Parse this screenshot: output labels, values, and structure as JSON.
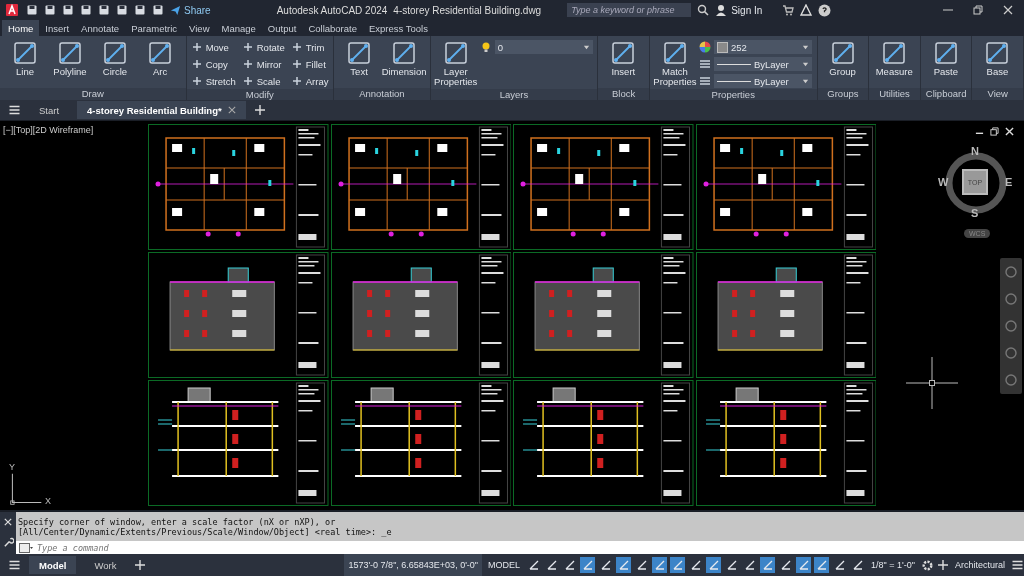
{
  "title_bar": {
    "share": "Share",
    "app_name": "Autodesk AutoCAD 2024",
    "file_name": "4-storey Residential Building.dwg",
    "search": {
      "placeholder": "Type a keyword or phrase"
    },
    "sign_in": "Sign In"
  },
  "ribbon_tabs": [
    {
      "label": "Home",
      "selected": true
    },
    {
      "label": "Insert",
      "selected": false
    },
    {
      "label": "Annotate",
      "selected": false
    },
    {
      "label": "Parametric",
      "selected": false
    },
    {
      "label": "View",
      "selected": false
    },
    {
      "label": "Manage",
      "selected": false
    },
    {
      "label": "Output",
      "selected": false
    },
    {
      "label": "Collaborate",
      "selected": false
    },
    {
      "label": "Express Tools",
      "selected": false
    }
  ],
  "ribbon_panels": [
    {
      "title": "Draw",
      "tools": [
        {
          "kind": "large",
          "label": "Line"
        },
        {
          "kind": "large",
          "label": "Polyline"
        },
        {
          "kind": "large",
          "label": "Circle"
        },
        {
          "kind": "large",
          "label": "Arc"
        }
      ]
    },
    {
      "title": "Modify",
      "tools": [
        {
          "kind": "small",
          "label": "Move"
        },
        {
          "kind": "small",
          "label": "Copy"
        },
        {
          "kind": "small",
          "label": "Stretch"
        },
        {
          "kind": "small",
          "label": "Rotate"
        },
        {
          "kind": "small",
          "label": "Mirror"
        },
        {
          "kind": "small",
          "label": "Scale"
        },
        {
          "kind": "small",
          "label": "Trim"
        },
        {
          "kind": "small",
          "label": "Fillet"
        },
        {
          "kind": "small",
          "label": "Array"
        }
      ]
    },
    {
      "title": "Annotation",
      "tools": [
        {
          "kind": "large",
          "label": "Text"
        },
        {
          "kind": "large",
          "label": "Dimension"
        }
      ]
    },
    {
      "title": "Layers",
      "tools": [
        {
          "kind": "large",
          "label": "Layer Properties"
        },
        {
          "kind": "layer_dropdown",
          "value": "0"
        }
      ]
    },
    {
      "title": "Block",
      "tools": [
        {
          "kind": "large",
          "label": "Insert"
        }
      ]
    },
    {
      "title": "Properties",
      "tools": [
        {
          "kind": "large",
          "label": "Match Properties"
        },
        {
          "kind": "color_dropdown",
          "value": "252"
        },
        {
          "kind": "line_dropdown",
          "value": "ByLayer"
        },
        {
          "kind": "line_dropdown",
          "value": "ByLayer"
        }
      ]
    },
    {
      "title": "Groups",
      "tools": [
        {
          "kind": "large",
          "label": "Group"
        }
      ]
    },
    {
      "title": "Utilities",
      "tools": [
        {
          "kind": "large",
          "label": "Measure"
        }
      ]
    },
    {
      "title": "Clipboard",
      "tools": [
        {
          "kind": "large",
          "label": "Paste"
        }
      ]
    },
    {
      "title": "View",
      "tools": [
        {
          "kind": "large",
          "label": "Base"
        }
      ]
    }
  ],
  "file_tabs": [
    {
      "label": "Start",
      "selected": false
    },
    {
      "label": "4-storey Residential Building*",
      "selected": true
    }
  ],
  "viewport": {
    "label": "[−][Top][2D Wireframe]",
    "viewcube": {
      "north": "N",
      "west": "W",
      "east": "E",
      "south": "S",
      "face": "TOP",
      "ucs": "WCS"
    },
    "ucs_icon": {
      "x": "X",
      "y": "Y"
    }
  },
  "sheets": [
    {
      "kind": "plan"
    },
    {
      "kind": "plan"
    },
    {
      "kind": "plan"
    },
    {
      "kind": "plan"
    },
    {
      "kind": "elevation"
    },
    {
      "kind": "elevation"
    },
    {
      "kind": "elevation"
    },
    {
      "kind": "elevation"
    },
    {
      "kind": "section"
    },
    {
      "kind": "section"
    },
    {
      "kind": "section"
    },
    {
      "kind": "section"
    }
  ],
  "command_line": {
    "history": [
      "Specify corner of window, enter a scale factor (nX or nXP), or",
      "[All/Center/Dynamic/Extents/Previous/Scale/Window/Object] <real time>: _e"
    ],
    "placeholder": "Type a command"
  },
  "status_bar": {
    "layout_tabs": [
      {
        "label": "Model",
        "selected": true
      },
      {
        "label": "Work",
        "selected": false
      }
    ],
    "coordinates": "1573'-0 7/8\", 6.65843E+03, 0'-0\"",
    "space": "MODEL",
    "scale": "1/8\" = 1'-0\"",
    "units": "Architectural",
    "toggles": [
      {
        "on": false
      },
      {
        "on": false
      },
      {
        "on": false
      },
      {
        "on": true
      },
      {
        "on": false
      },
      {
        "on": true
      },
      {
        "on": false
      },
      {
        "on": true
      },
      {
        "on": true
      },
      {
        "on": false
      },
      {
        "on": true
      },
      {
        "on": false
      },
      {
        "on": false
      },
      {
        "on": true
      },
      {
        "on": false
      },
      {
        "on": true
      },
      {
        "on": true
      },
      {
        "on": false
      },
      {
        "on": false
      }
    ]
  }
}
